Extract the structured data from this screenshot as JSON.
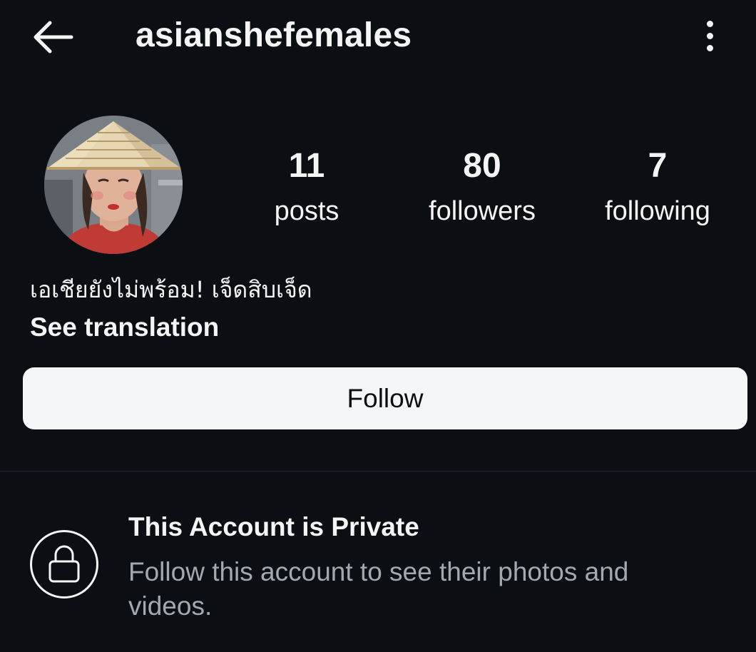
{
  "header": {
    "back_icon": "arrow-left-icon",
    "username": "asianshefemales",
    "more_icon": "more-vertical-icon"
  },
  "profile": {
    "avatar_icon": "profile-avatar",
    "stats": [
      {
        "value": "11",
        "label": "posts"
      },
      {
        "value": "80",
        "label": "followers"
      },
      {
        "value": "7",
        "label": "following"
      }
    ],
    "bio": "เอเชียยังไม่พร้อม! เจ็ดสิบเจ็ด",
    "see_translation": "See translation"
  },
  "actions": {
    "follow_label": "Follow"
  },
  "private_notice": {
    "icon": "lock-icon",
    "title": "This Account is Private",
    "description": "Follow this account to see their photos and videos."
  },
  "colors": {
    "background": "#0b0f14",
    "text": "#f5f5f5",
    "muted_text": "#a4a9b1",
    "button_bg": "#f5f6f8",
    "divider": "#262a30"
  }
}
